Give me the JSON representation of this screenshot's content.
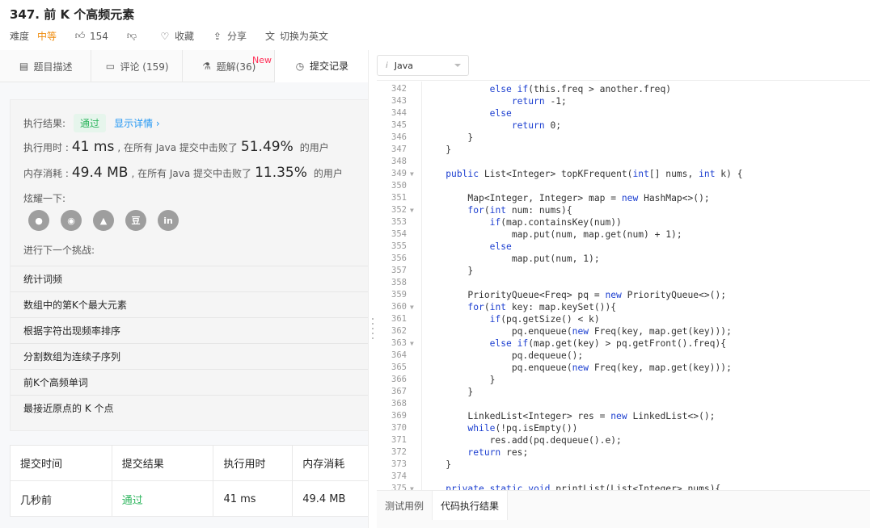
{
  "problem": {
    "title": "347. 前 K 个高频元素",
    "difficulty_label": "难度",
    "difficulty": "中等",
    "likes": "154",
    "favorite": "收藏",
    "share": "分享",
    "switch_lang": "切换为英文"
  },
  "tabs": [
    {
      "label": "题目描述",
      "icon": "document-icon"
    },
    {
      "label": "评论 (159)",
      "icon": "comment-icon"
    },
    {
      "label": "题解(36)",
      "icon": "flask-icon",
      "badge": "New"
    },
    {
      "label": "提交记录",
      "icon": "clock-icon"
    }
  ],
  "result": {
    "exec_result_label": "执行结果:",
    "status": "通过",
    "detail_link": "显示详情 ›",
    "runtime_label": "执行用时 :",
    "runtime_value": "41 ms",
    "runtime_text": ", 在所有 Java 提交中击败了",
    "runtime_percent": "51.49%",
    "users_suffix": "的用户",
    "memory_label": "内存消耗 :",
    "memory_value": "49.4 MB",
    "memory_text": ", 在所有 Java 提交中击败了",
    "memory_percent": "11.35%",
    "share_label": "炫耀一下:",
    "social": [
      "wechat-icon",
      "weibo-icon",
      "qq-icon",
      "douban-icon",
      "linkedin-icon"
    ],
    "social_glyphs": [
      "●",
      "◉",
      "▲",
      "豆",
      "in"
    ],
    "next_label": "进行下一个挑战:",
    "challenges": [
      "统计词频",
      "数组中的第K个最大元素",
      "根据字符出现频率排序",
      "分割数组为连续子序列",
      "前K个高频单词",
      "最接近原点的 K 个点"
    ]
  },
  "submissions": {
    "headers": [
      "提交时间",
      "提交结果",
      "执行用时",
      "内存消耗"
    ],
    "rows": [
      [
        "几秒前",
        "通过",
        "41 ms",
        "49.4 MB"
      ]
    ]
  },
  "editor": {
    "language": "Java",
    "lines": [
      {
        "n": "342",
        "fold": false,
        "code": [
          [
            "            ",
            ""
          ],
          [
            "else if",
            "kw"
          ],
          [
            "(this.freq > another.freq)",
            ""
          ]
        ]
      },
      {
        "n": "343",
        "fold": false,
        "code": [
          [
            "                ",
            ""
          ],
          [
            "return",
            "kw"
          ],
          [
            " -1;",
            ""
          ]
        ]
      },
      {
        "n": "344",
        "fold": false,
        "code": [
          [
            "            ",
            ""
          ],
          [
            "else",
            "kw"
          ]
        ]
      },
      {
        "n": "345",
        "fold": false,
        "code": [
          [
            "                ",
            ""
          ],
          [
            "return",
            "kw"
          ],
          [
            " 0;",
            ""
          ]
        ]
      },
      {
        "n": "346",
        "fold": false,
        "code": [
          [
            "        }",
            ""
          ]
        ]
      },
      {
        "n": "347",
        "fold": false,
        "code": [
          [
            "    }",
            ""
          ]
        ]
      },
      {
        "n": "348",
        "fold": false,
        "code": [
          [
            "",
            ""
          ]
        ]
      },
      {
        "n": "349",
        "fold": true,
        "code": [
          [
            "    ",
            ""
          ],
          [
            "public",
            "kw"
          ],
          [
            " List<Integer> topKFrequent(",
            ""
          ],
          [
            "int",
            "kw"
          ],
          [
            "[] nums, ",
            ""
          ],
          [
            "int",
            "kw"
          ],
          [
            " k) {",
            ""
          ]
        ]
      },
      {
        "n": "350",
        "fold": false,
        "code": [
          [
            "",
            ""
          ]
        ]
      },
      {
        "n": "351",
        "fold": false,
        "code": [
          [
            "        Map<Integer, Integer> map = ",
            ""
          ],
          [
            "new",
            "kw"
          ],
          [
            " HashMap<>();",
            ""
          ]
        ]
      },
      {
        "n": "352",
        "fold": true,
        "code": [
          [
            "        ",
            ""
          ],
          [
            "for",
            "kw"
          ],
          [
            "(",
            ""
          ],
          [
            "int",
            "kw"
          ],
          [
            " num: nums){",
            ""
          ]
        ]
      },
      {
        "n": "353",
        "fold": false,
        "code": [
          [
            "            ",
            ""
          ],
          [
            "if",
            "kw"
          ],
          [
            "(map.containsKey(num))",
            ""
          ]
        ]
      },
      {
        "n": "354",
        "fold": false,
        "code": [
          [
            "                map.put(num, map.get(num) + 1);",
            ""
          ]
        ]
      },
      {
        "n": "355",
        "fold": false,
        "code": [
          [
            "            ",
            ""
          ],
          [
            "else",
            "kw"
          ]
        ]
      },
      {
        "n": "356",
        "fold": false,
        "code": [
          [
            "                map.put(num, 1);",
            ""
          ]
        ]
      },
      {
        "n": "357",
        "fold": false,
        "code": [
          [
            "        }",
            ""
          ]
        ]
      },
      {
        "n": "358",
        "fold": false,
        "code": [
          [
            "",
            ""
          ]
        ]
      },
      {
        "n": "359",
        "fold": false,
        "code": [
          [
            "        PriorityQueue<Freq> pq = ",
            ""
          ],
          [
            "new",
            "kw"
          ],
          [
            " PriorityQueue<>();",
            ""
          ]
        ]
      },
      {
        "n": "360",
        "fold": true,
        "code": [
          [
            "        ",
            ""
          ],
          [
            "for",
            "kw"
          ],
          [
            "(",
            ""
          ],
          [
            "int",
            "kw"
          ],
          [
            " key: map.keySet()){",
            ""
          ]
        ]
      },
      {
        "n": "361",
        "fold": false,
        "code": [
          [
            "            ",
            ""
          ],
          [
            "if",
            "kw"
          ],
          [
            "(pq.getSize() < k)",
            ""
          ]
        ]
      },
      {
        "n": "362",
        "fold": false,
        "code": [
          [
            "                pq.enqueue(",
            ""
          ],
          [
            "new",
            "kw"
          ],
          [
            " Freq(key, map.get(key)));",
            ""
          ]
        ]
      },
      {
        "n": "363",
        "fold": true,
        "code": [
          [
            "            ",
            ""
          ],
          [
            "else if",
            "kw"
          ],
          [
            "(map.get(key) > pq.getFront().freq){",
            ""
          ]
        ]
      },
      {
        "n": "364",
        "fold": false,
        "code": [
          [
            "                pq.dequeue();",
            ""
          ]
        ]
      },
      {
        "n": "365",
        "fold": false,
        "code": [
          [
            "                pq.enqueue(",
            ""
          ],
          [
            "new",
            "kw"
          ],
          [
            " Freq(key, map.get(key)));",
            ""
          ]
        ]
      },
      {
        "n": "366",
        "fold": false,
        "code": [
          [
            "            }",
            ""
          ]
        ]
      },
      {
        "n": "367",
        "fold": false,
        "code": [
          [
            "        }",
            ""
          ]
        ]
      },
      {
        "n": "368",
        "fold": false,
        "code": [
          [
            "",
            ""
          ]
        ]
      },
      {
        "n": "369",
        "fold": false,
        "code": [
          [
            "        LinkedList<Integer> res = ",
            ""
          ],
          [
            "new",
            "kw"
          ],
          [
            " LinkedList<>();",
            ""
          ]
        ]
      },
      {
        "n": "370",
        "fold": false,
        "code": [
          [
            "        ",
            ""
          ],
          [
            "while",
            "kw"
          ],
          [
            "(!pq.isEmpty())",
            ""
          ]
        ]
      },
      {
        "n": "371",
        "fold": false,
        "code": [
          [
            "            res.add(pq.dequeue().e);",
            ""
          ]
        ]
      },
      {
        "n": "372",
        "fold": false,
        "code": [
          [
            "        ",
            ""
          ],
          [
            "return",
            "kw"
          ],
          [
            " res;",
            ""
          ]
        ]
      },
      {
        "n": "373",
        "fold": false,
        "code": [
          [
            "    }",
            ""
          ]
        ]
      },
      {
        "n": "374",
        "fold": false,
        "code": [
          [
            "",
            ""
          ]
        ]
      },
      {
        "n": "375",
        "fold": true,
        "code": [
          [
            "    ",
            ""
          ],
          [
            "private static void",
            "kw"
          ],
          [
            " printList(List<Integer> nums){",
            ""
          ]
        ]
      }
    ],
    "bottom_tabs": [
      "测试用例",
      "代码执行结果"
    ]
  },
  "colors": {
    "accent_green": "#2db55d",
    "difficulty_orange": "#ef8c0e",
    "link_blue": "#2196f3",
    "keyword_blue": "#1e40d0",
    "new_red": "#ff2d55"
  }
}
